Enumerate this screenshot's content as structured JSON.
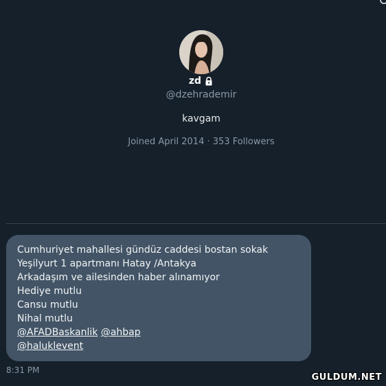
{
  "profile": {
    "display_name": "zd",
    "handle": "@dzehrademir",
    "bio": "kavgam",
    "joined": "Joined April 2014",
    "separator": "·",
    "followers": "353 Followers"
  },
  "message": {
    "lines": [
      "Cumhuriyet mahallesi gündüz caddesi bostan sokak",
      "Yeşilyurt 1 apartmanı Hatay /Antakya",
      "Arkadaşım ve ailesinden haber alınamıyor",
      "Hediye mutlu",
      "Cansu mutlu",
      "Nihal mutlu"
    ],
    "mentions": [
      "@AFADBaskanlik",
      "@ahbap",
      "@haluklevent"
    ],
    "timestamp": "8:31 PM"
  },
  "watermark": "GULDUM.NET",
  "icons": {
    "lock": "lock-icon",
    "corner": "search-icon"
  },
  "colors": {
    "background": "#15202b",
    "bubble": "#425466",
    "secondary_text": "#8b98a5"
  }
}
